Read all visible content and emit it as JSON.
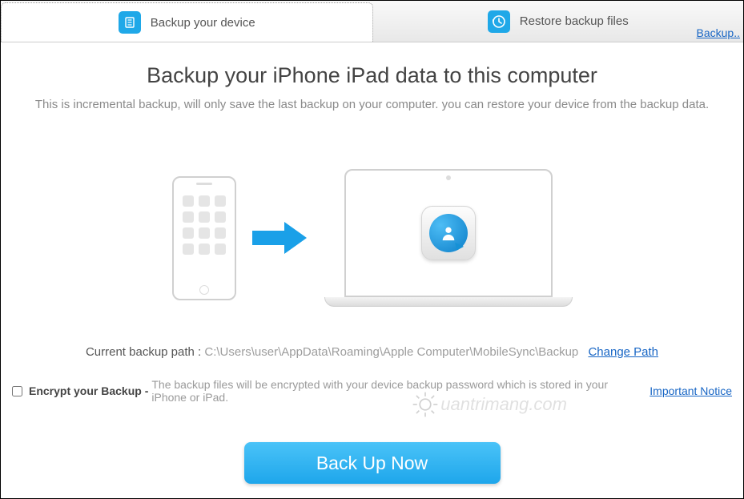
{
  "tabs": {
    "backup": "Backup your device",
    "restore": "Restore backup files"
  },
  "corner_link": "Backup..",
  "headline": "Backup your iPhone iPad data to this computer",
  "subtext": "This is incremental backup, will only save the last backup on your computer. you can restore your device from the backup data.",
  "path": {
    "label": "Current backup path :",
    "value": "C:\\Users\\user\\AppData\\Roaming\\Apple Computer\\MobileSync\\Backup",
    "change": "Change Path"
  },
  "encrypt": {
    "label": "Encrypt your Backup -",
    "desc": "The backup files will be encrypted with your device backup password which is stored in your iPhone or iPad.",
    "notice": "Important Notice"
  },
  "button": "Back Up Now",
  "watermark": "uantrimang.com"
}
